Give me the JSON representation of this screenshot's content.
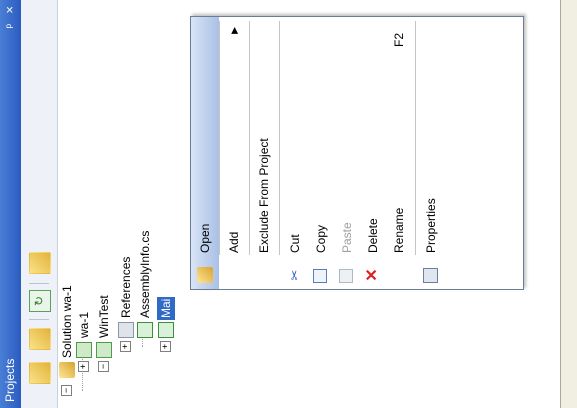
{
  "panel": {
    "title": "Projects",
    "pin_glyph": "ᵖ",
    "close_glyph": "×"
  },
  "tree": {
    "solution": "Solution wa-1",
    "project": "wa-1",
    "wintest": "WinTest",
    "references": "References",
    "assemblyinfo": "AssemblyInfo.cs",
    "selected_item": "Mai",
    "expand_glyph": "⊟",
    "plus_glyph": "+",
    "minus_glyph": "−"
  },
  "menu": {
    "items": [
      {
        "label": "Open",
        "shortcut": "",
        "icon": "folder-icon"
      },
      {
        "label": "Add",
        "shortcut": "",
        "icon": ""
      },
      {
        "label": "Exclude From Project",
        "shortcut": "",
        "icon": ""
      },
      {
        "label": "Cut",
        "shortcut": "",
        "icon": "scissors-icon"
      },
      {
        "label": "Copy",
        "shortcut": "",
        "icon": "copy-icon"
      },
      {
        "label": "Paste",
        "shortcut": "",
        "icon": "paste-icon"
      },
      {
        "label": "Delete",
        "shortcut": "",
        "icon": "delete-icon"
      },
      {
        "label": "Rename",
        "shortcut": "F2",
        "icon": ""
      },
      {
        "label": "Properties",
        "shortcut": "",
        "icon": "properties-icon"
      }
    ],
    "submenu_arrow": "▶",
    "cut_glyph": "✂",
    "delete_glyph": "✕"
  },
  "colors": {
    "title_bar": "#2a5cc0",
    "selection": "#316ac5",
    "delete": "#e02020"
  }
}
